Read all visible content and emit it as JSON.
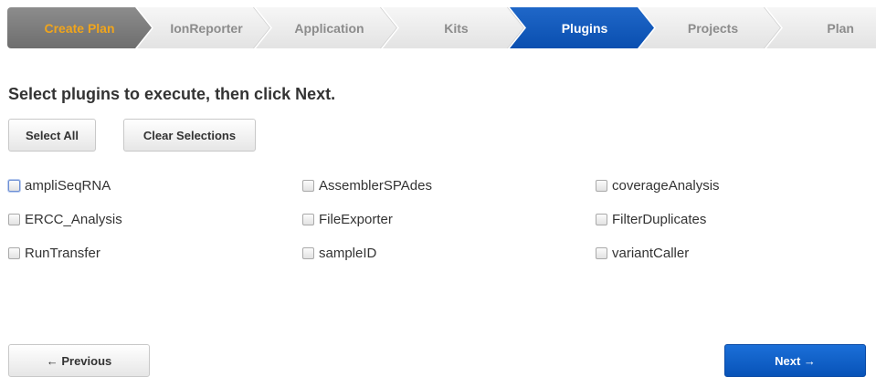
{
  "wizard": {
    "steps": [
      {
        "label": "Create Plan",
        "state": "done"
      },
      {
        "label": "IonReporter",
        "state": "inactive"
      },
      {
        "label": "Application",
        "state": "inactive"
      },
      {
        "label": "Kits",
        "state": "inactive"
      },
      {
        "label": "Plugins",
        "state": "active"
      },
      {
        "label": "Projects",
        "state": "inactive"
      },
      {
        "label": "Plan",
        "state": "inactive"
      }
    ]
  },
  "page": {
    "heading": "Select plugins to execute, then click Next."
  },
  "actions": {
    "select_all": "Select All",
    "clear_selections": "Clear Selections"
  },
  "plugins": [
    {
      "label": "ampliSeqRNA",
      "checked": false
    },
    {
      "label": "AssemblerSPAdes",
      "checked": false
    },
    {
      "label": "coverageAnalysis",
      "checked": false
    },
    {
      "label": "ERCC_Analysis",
      "checked": false
    },
    {
      "label": "FileExporter",
      "checked": false
    },
    {
      "label": "FilterDuplicates",
      "checked": false
    },
    {
      "label": "RunTransfer",
      "checked": false
    },
    {
      "label": "sampleID",
      "checked": false
    },
    {
      "label": "variantCaller",
      "checked": false
    }
  ],
  "footer": {
    "previous": "← Previous",
    "next": "Next →"
  },
  "colors": {
    "active_step": "#0a4fb0",
    "done_step_text": "#f0a51c",
    "done_step_bg": "#7d7d7d",
    "next_button": "#0853b8"
  }
}
